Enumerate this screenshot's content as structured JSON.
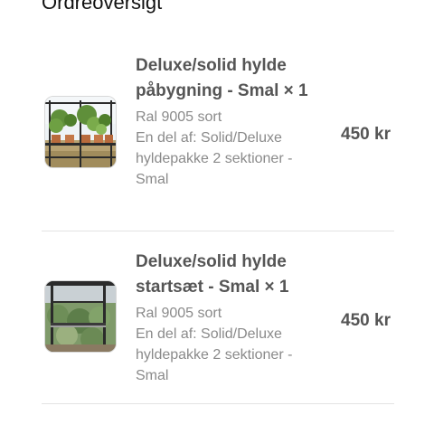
{
  "section_title": "Ordreoversigt",
  "items": [
    {
      "name": "Deluxe/solid hylde påbygning - Smal × 1",
      "variant": "Ral 9005 sort",
      "part_of": "En del af: Solid/Deluxe hyldepakke 2 sektioner - Smal",
      "price": "450 kr",
      "image_icon": "greenhouse-shelf-plants-photo"
    },
    {
      "name": "Deluxe/solid hylde startsæt - Smal × 1",
      "variant": "Ral 9005 sort",
      "part_of": "En del af: Solid/Deluxe hyldepakke 2 sektioner - Smal",
      "price": "450 kr",
      "image_icon": "greenhouse-interior-photo"
    }
  ],
  "colors": {
    "title": "#111111",
    "name": "#555555",
    "detail": "#8a8a8a",
    "divider": "#e3e3e3"
  }
}
